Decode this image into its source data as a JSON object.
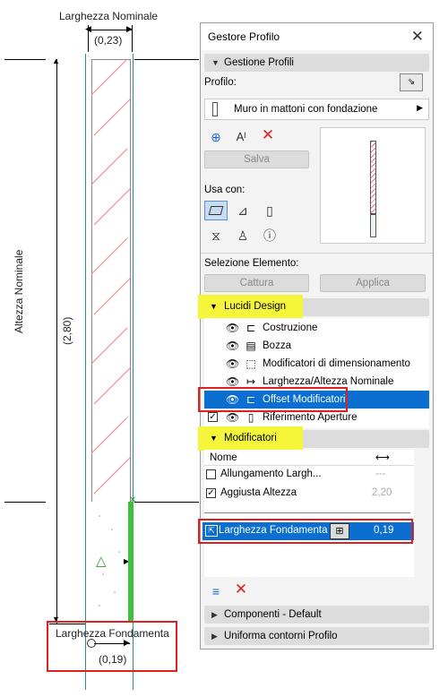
{
  "canvas": {
    "nominal_width_label": "Larghezza Nominale",
    "nominal_width_value": "(0,23)",
    "nominal_height_label": "Altezza Nominale",
    "nominal_height_value": "(2,80)",
    "foundation_width_label": "Larghezza Fondamenta",
    "foundation_width_value": "(0,19)"
  },
  "panel": {
    "title": "Gestore Profilo",
    "close": "✕",
    "section_gestione": "Gestione Profili",
    "profilo_label": "Profilo:",
    "profile_name": "Muro in mattoni con fondazione",
    "save_button": "Salva",
    "usa_con_label": "Usa con:",
    "selezione_label": "Selezione Elemento:",
    "cattura_button": "Cattura",
    "applica_button": "Applica",
    "section_lucidi": "Lucidi Design",
    "layers": [
      {
        "label": "Costruzione"
      },
      {
        "label": "Bozza"
      },
      {
        "label": "Modificatori di dimensionamento"
      },
      {
        "label": "Larghezza/Altezza Nominale"
      },
      {
        "label": "Offset Modificatori"
      },
      {
        "label": "Riferimento Aperture"
      }
    ],
    "section_modificatori": "Modificatori",
    "mod_header_name": "Nome",
    "modifiers": [
      {
        "name": "Allungamento Largh...",
        "value": "---"
      },
      {
        "name": "Aggiusta Altezza",
        "value": "2,20"
      }
    ],
    "selected_modifier": {
      "name": "Larghezza Fondamenta",
      "value": "0,19"
    },
    "section_componenti": "Componenti - Default",
    "section_uniforma": "Uniforma contorni Profilo",
    "colors": {
      "selection": "#0a6fd0",
      "highlight": "#f5f53a",
      "annotation_red": "#e0201e"
    }
  }
}
